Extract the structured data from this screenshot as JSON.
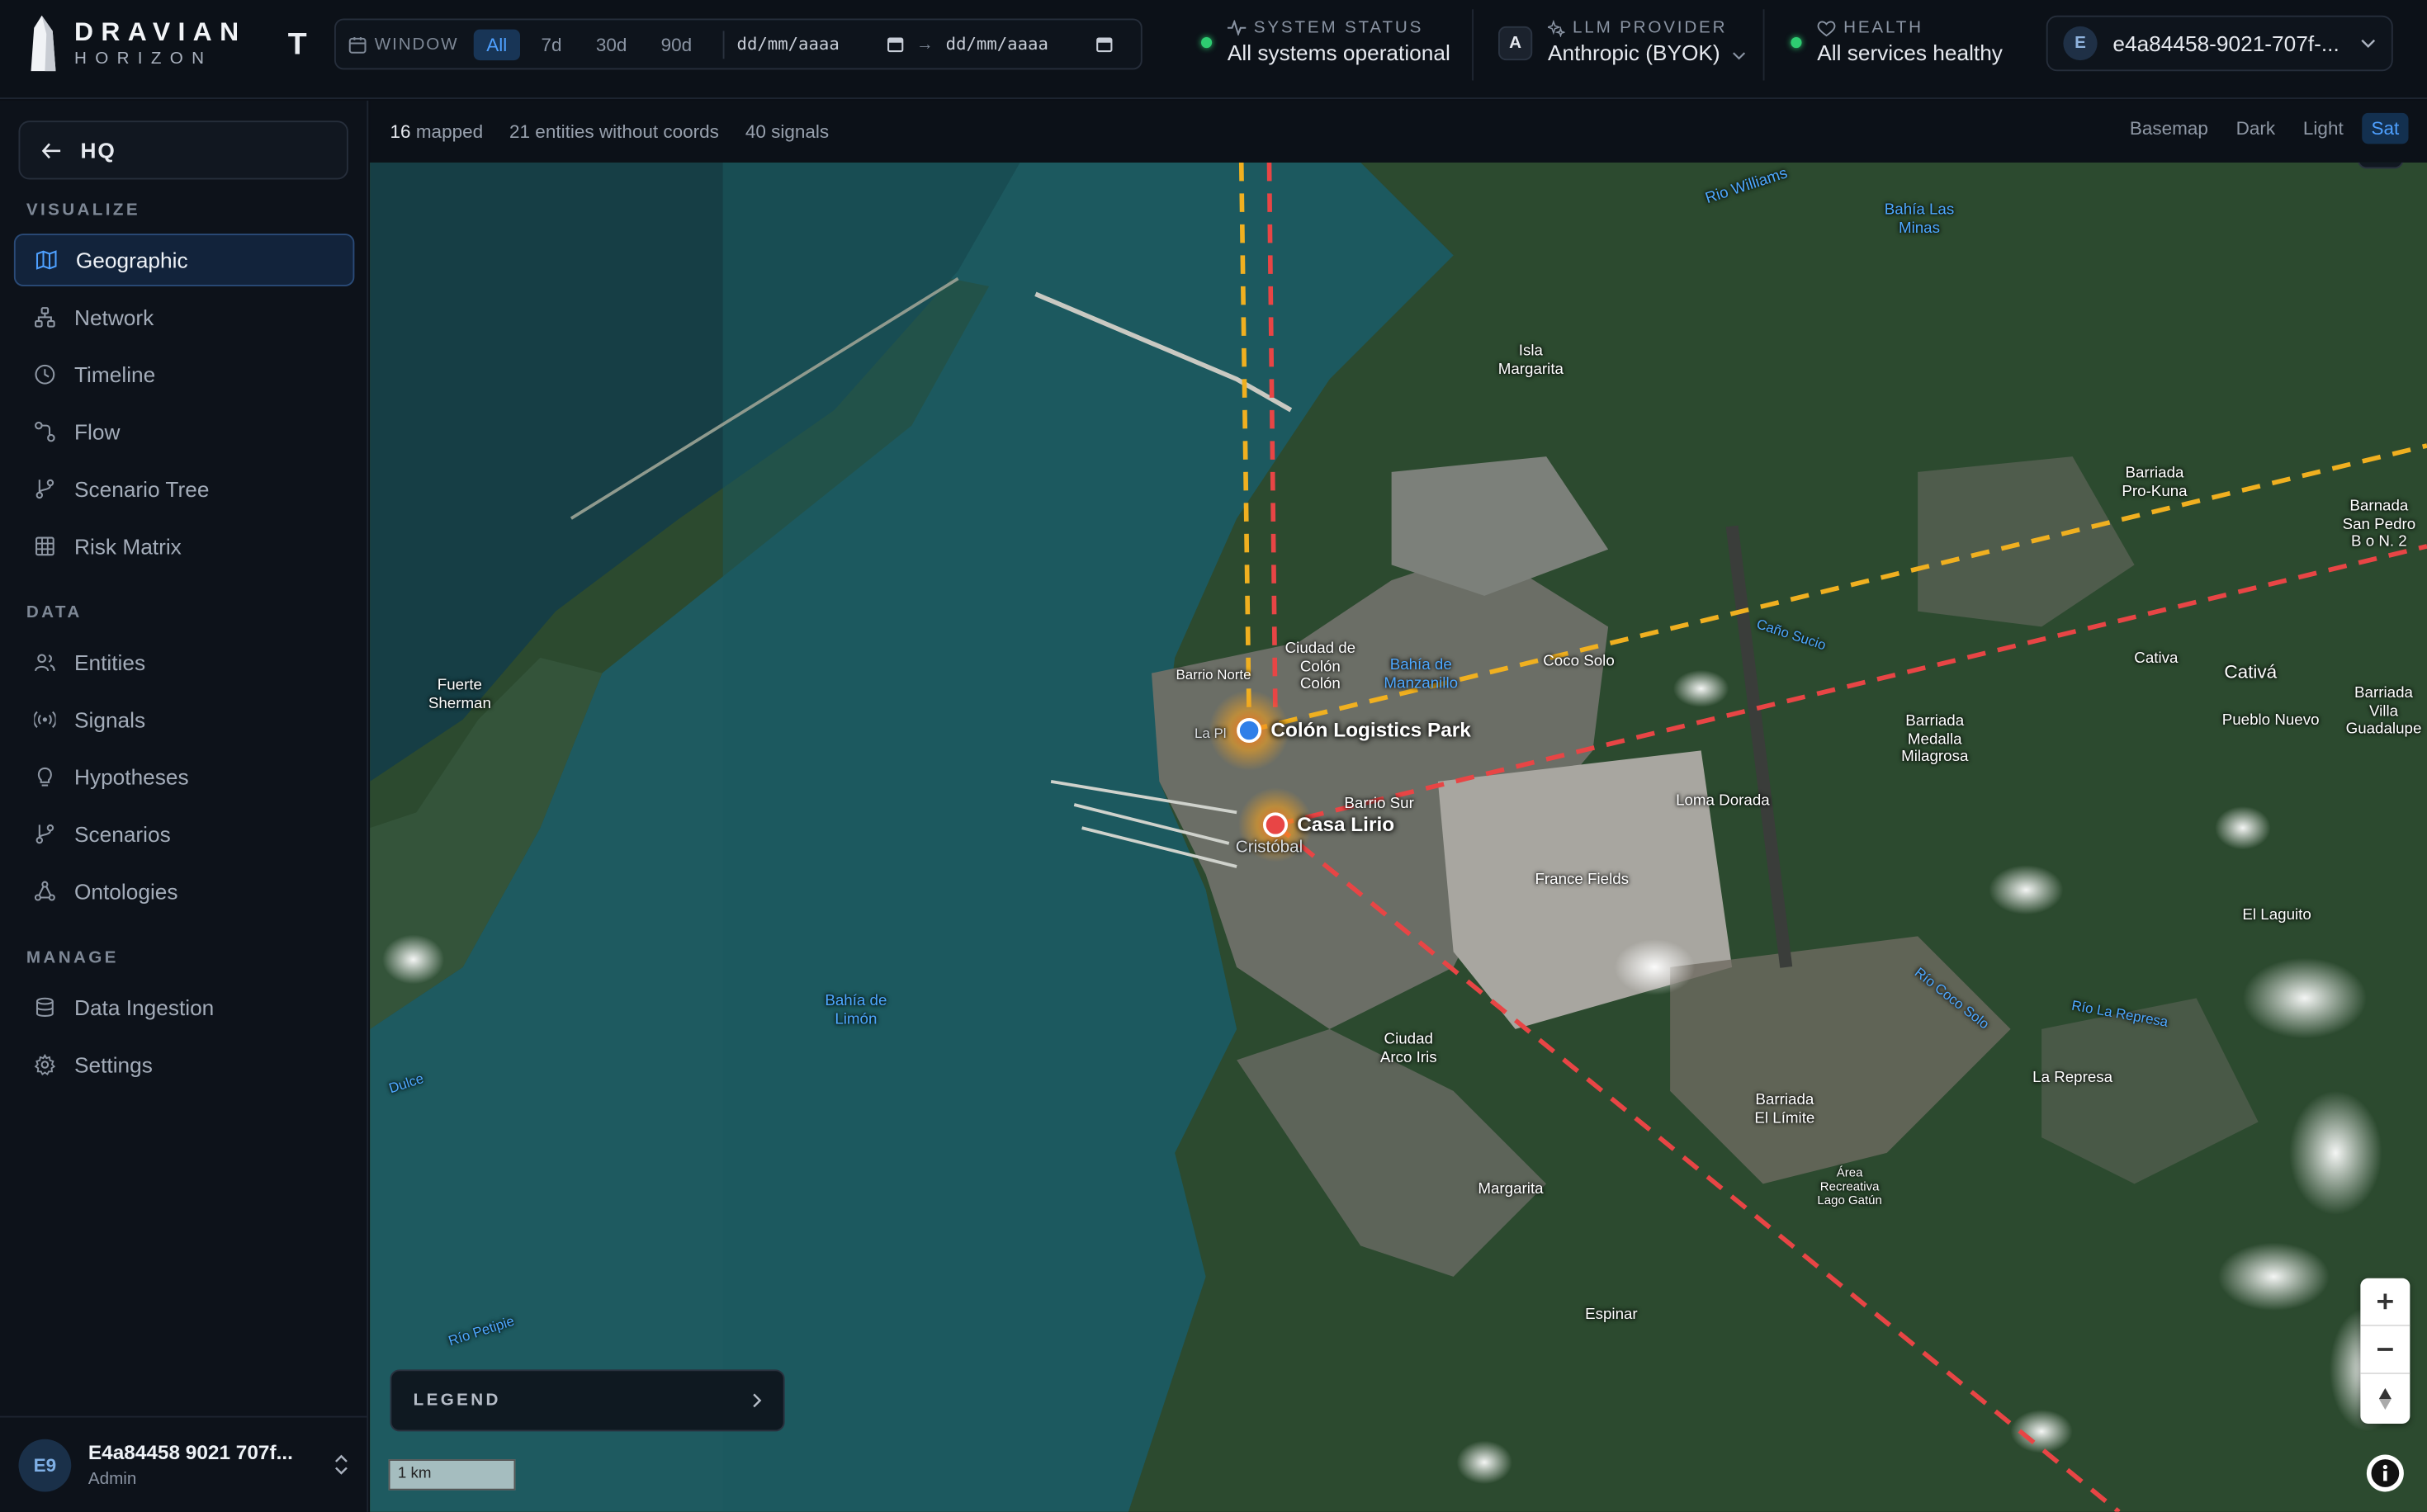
{
  "brand": {
    "name": "DRAVIAN",
    "sub": "HORIZON",
    "workspace_initial": "T"
  },
  "window": {
    "label": "WINDOW",
    "options": [
      "All",
      "7d",
      "30d",
      "90d"
    ],
    "active": "All",
    "from_placeholder": "dd/mm/aaaa",
    "to_placeholder": "dd/mm/aaaa"
  },
  "system_status": {
    "label": "SYSTEM STATUS",
    "value": "All systems operational"
  },
  "llm_provider": {
    "badge": "A",
    "label": "LLM PROVIDER",
    "value": "Anthropic (BYOK)"
  },
  "health": {
    "label": "HEALTH",
    "value": "All services healthy"
  },
  "account": {
    "avatar": "E",
    "id": "e4a84458-9021-707f-..."
  },
  "sidebar": {
    "hq_label": "HQ",
    "sections": [
      {
        "title": "VISUALIZE",
        "items": [
          "Geographic",
          "Network",
          "Timeline",
          "Flow",
          "Scenario Tree",
          "Risk Matrix"
        ]
      },
      {
        "title": "DATA",
        "items": [
          "Entities",
          "Signals",
          "Hypotheses",
          "Scenarios",
          "Ontologies"
        ]
      },
      {
        "title": "MANAGE",
        "items": [
          "Data Ingestion",
          "Settings"
        ]
      }
    ],
    "active_item": "Geographic",
    "user": {
      "initials": "E9",
      "name": "E4a84458 9021 707f...",
      "role": "Admin"
    }
  },
  "map_toolbar": {
    "mapped_count": "16",
    "mapped_label": "mapped",
    "without_coords": "21 entities without coords",
    "signals": "40 signals",
    "basemap_label": "Basemap",
    "basemap_options": [
      "Dark",
      "Light",
      "Sat"
    ],
    "basemap_active": "Sat"
  },
  "map": {
    "markers": [
      {
        "name": "Colón Logistics Park",
        "color": "#2f7fe8"
      },
      {
        "name": "Casa Lirio",
        "color": "#e84545"
      }
    ],
    "places": [
      "Rio Williams",
      "Bahía Las\nMinas",
      "Isla\nMargarita",
      "Barriada\nPro-Kuna",
      "Barnada\nSan Pedro\nB o N. 2",
      "Ciudad de\nColón\nColón",
      "Bahía de\nManzanillo",
      "Barrio Norte",
      "Coco Solo",
      "Caño Sucio",
      "Fuerte\nSherman",
      "Cativa",
      "Cativá",
      "Barriada\nVilla\nGuadalupe",
      "Pueblo Nuevo",
      "Barriada\nMedalla\nMilagrosa",
      "Loma Dorada",
      "Barrio Sur",
      "Cristóbal",
      "France Fields",
      "El Laguito",
      "Bahía de\nLimón",
      "Río Coco Solo",
      "Río La Represa",
      "Ciudad\nArco Iris",
      "La Represa",
      "Barriada\nEl Límite",
      "Área\nRecreativa\nLago Gatún",
      "Margarita",
      "Espinar",
      "Río Petipie",
      "Dulce",
      "La Pl"
    ],
    "legend_label": "LEGEND",
    "scale_label": "1 km"
  },
  "colors": {
    "accent": "#4ea0ff",
    "ok": "#2ecc71",
    "route_orange": "#f0b020",
    "route_red": "#e84545"
  }
}
